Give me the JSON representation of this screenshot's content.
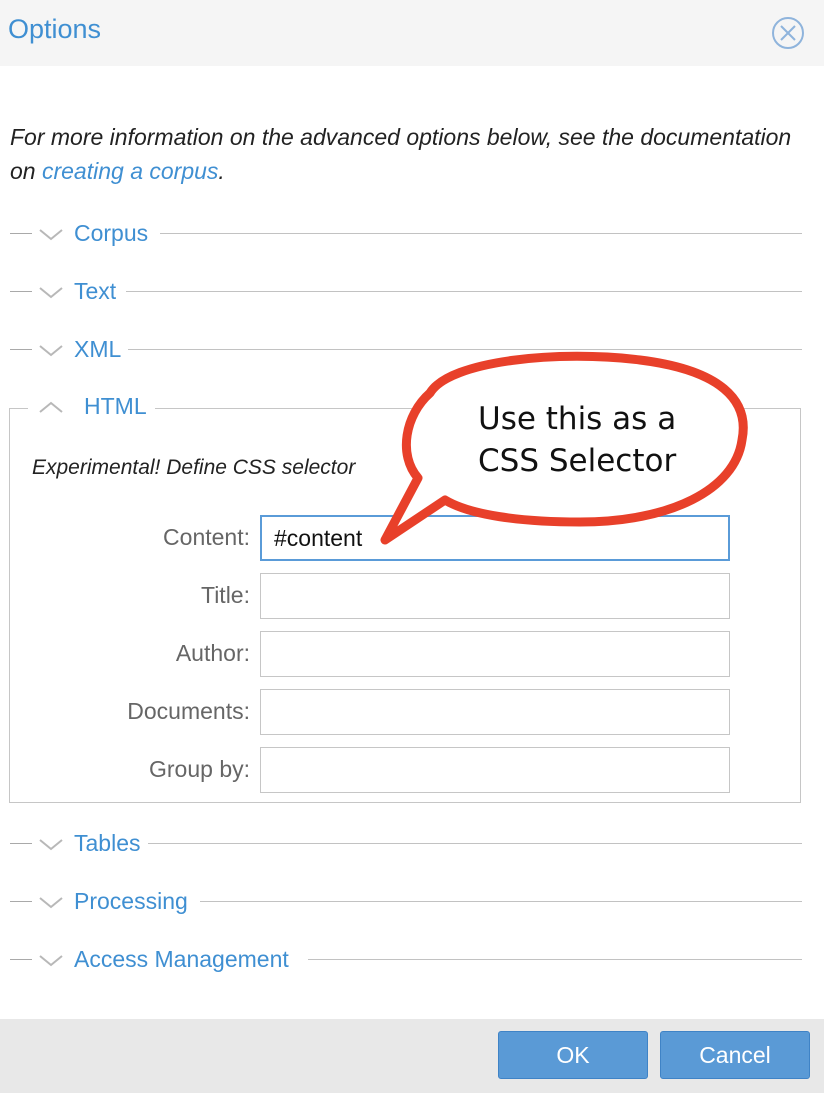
{
  "dialog": {
    "title": "Options",
    "close_icon": "close-icon"
  },
  "intro": {
    "text_before": "For more information on the advanced options below, see the documentation on ",
    "link": "creating a corpus",
    "text_after": "."
  },
  "sections": {
    "corpus": "Corpus",
    "text": "Text",
    "xml": "XML",
    "html": "HTML",
    "tables": "Tables",
    "processing": "Processing",
    "access": "Access Management"
  },
  "html_section": {
    "note": "Experimental! Define CSS selector",
    "fields": {
      "content": {
        "label": "Content:",
        "value": "#content"
      },
      "title": {
        "label": "Title:",
        "value": ""
      },
      "author": {
        "label": "Author:",
        "value": ""
      },
      "documents": {
        "label": "Documents:",
        "value": ""
      },
      "group_by": {
        "label": "Group by:",
        "value": ""
      }
    }
  },
  "callout": {
    "line1": "Use this as a",
    "line2": "CSS Selector"
  },
  "footer": {
    "ok_label": "OK",
    "cancel_label": "Cancel"
  },
  "colors": {
    "accent": "#3f8fd2",
    "button": "#5a9ad6",
    "callout_border": "#e8402a"
  }
}
